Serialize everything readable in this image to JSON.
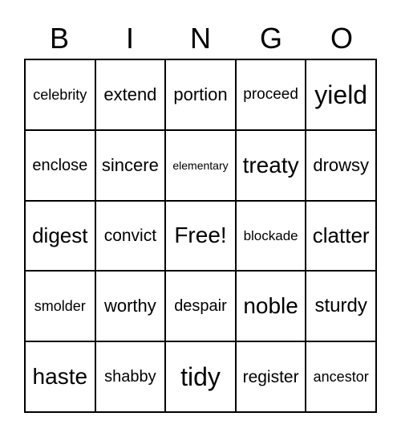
{
  "header": [
    "B",
    "I",
    "N",
    "G",
    "O"
  ],
  "cells": [
    "celebrity",
    "extend",
    "portion",
    "proceed",
    "yield",
    "enclose",
    "sincere",
    "elementary",
    "treaty",
    "drowsy",
    "digest",
    "convict",
    "Free!",
    "blockade",
    "clatter",
    "smolder",
    "worthy",
    "despair",
    "noble",
    "sturdy",
    "haste",
    "shabby",
    "tidy",
    "register",
    "ancestor"
  ]
}
